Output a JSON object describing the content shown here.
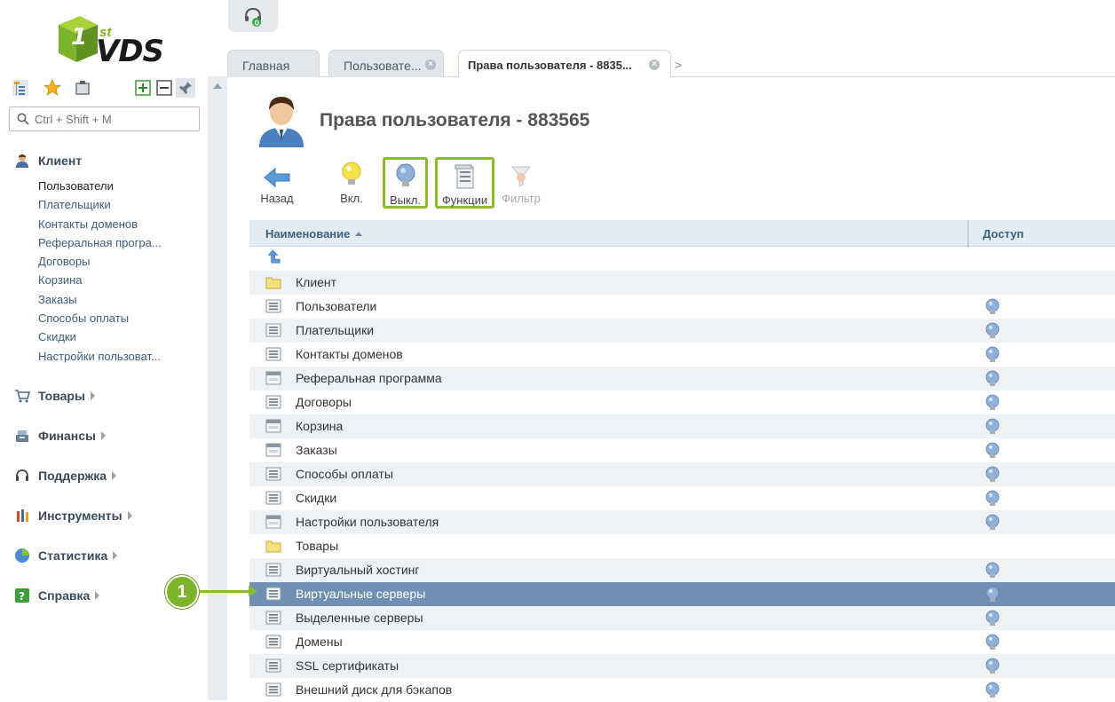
{
  "logo": {
    "sup": "st",
    "text": "VDS"
  },
  "sidebar": {
    "search_placeholder": "Ctrl + Shift + M",
    "sections": [
      {
        "label": "Клиент",
        "icon": "client-icon",
        "expanded": true
      },
      {
        "label": "Товары",
        "icon": "cart-icon"
      },
      {
        "label": "Финансы",
        "icon": "cash-register-icon"
      },
      {
        "label": "Поддержка",
        "icon": "headset-icon"
      },
      {
        "label": "Инструменты",
        "icon": "tools-icon"
      },
      {
        "label": "Статистика",
        "icon": "pie-chart-icon"
      },
      {
        "label": "Справка",
        "icon": "help-icon"
      }
    ],
    "client_items": [
      "Пользователи",
      "Плательщики",
      "Контакты доменов",
      "Реферальная програ...",
      "Договоры",
      "Корзина",
      "Заказы",
      "Способы оплаты",
      "Скидки",
      "Настройки пользоват..."
    ]
  },
  "support": {
    "badge": "0"
  },
  "tabs": [
    {
      "label": "Главная"
    },
    {
      "label": "Пользовате..."
    },
    {
      "label": "Права пользователя - 8835..."
    }
  ],
  "page": {
    "title": "Права пользователя - 883565"
  },
  "toolbar": {
    "back": "Назад",
    "on": "Вкл.",
    "off": "Выкл.",
    "functions": "Функции",
    "filter": "Фильтр"
  },
  "grid": {
    "col_name": "Наименование",
    "col_access": "Доступ",
    "rows": [
      {
        "type": "folder",
        "name": "Клиент"
      },
      {
        "type": "list",
        "name": "Пользователи",
        "access": true
      },
      {
        "type": "list",
        "name": "Плательщики",
        "access": true
      },
      {
        "type": "list",
        "name": "Контакты доменов",
        "access": true
      },
      {
        "type": "form",
        "name": "Реферальная программа",
        "access": true
      },
      {
        "type": "list",
        "name": "Договоры",
        "access": true
      },
      {
        "type": "form",
        "name": "Корзина",
        "access": true
      },
      {
        "type": "form",
        "name": "Заказы",
        "access": true
      },
      {
        "type": "list",
        "name": "Способы оплаты",
        "access": true
      },
      {
        "type": "list",
        "name": "Скидки",
        "access": true
      },
      {
        "type": "form",
        "name": "Настройки пользователя",
        "access": true
      },
      {
        "type": "folder",
        "name": "Товары"
      },
      {
        "type": "list",
        "name": "Виртуальный хостинг",
        "access": true
      },
      {
        "type": "list",
        "name": "Виртуальные серверы",
        "access": true,
        "selected": true
      },
      {
        "type": "list",
        "name": "Выделенные серверы",
        "access": true
      },
      {
        "type": "list",
        "name": "Домены",
        "access": true
      },
      {
        "type": "list",
        "name": "SSL сертификаты",
        "access": true
      },
      {
        "type": "list",
        "name": "Внешний диск для бэкапов",
        "access": true
      }
    ]
  },
  "callout": {
    "number": "1"
  },
  "colors": {
    "accent_green": "#8cbc2a",
    "selected_row": "#6f90b3",
    "header_bg": "#e4ecf3"
  }
}
